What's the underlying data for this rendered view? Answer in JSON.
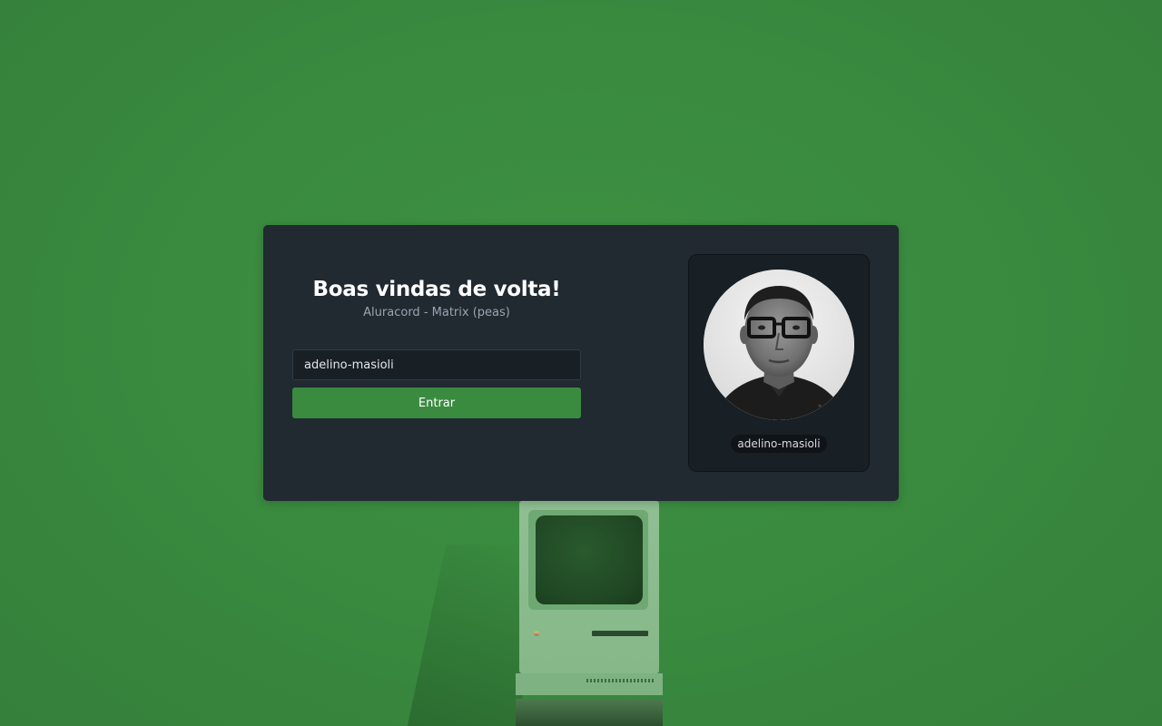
{
  "colors": {
    "background": "#3a8b40",
    "card": "#212931",
    "input_bg": "#181f25",
    "primary_button": "#3a8b40",
    "title_text": "#ffffff",
    "subtitle_text": "#9aa5b1"
  },
  "login": {
    "title": "Boas vindas de volta!",
    "subtitle": "Aluracord - Matrix (peas)",
    "username_input": {
      "value": "adelino-masioli",
      "placeholder": ""
    },
    "submit_label": "Entrar"
  },
  "profile": {
    "avatar_icon": "user-photo",
    "username": "adelino-masioli"
  },
  "background_image": {
    "icon": "vintage-computer"
  }
}
